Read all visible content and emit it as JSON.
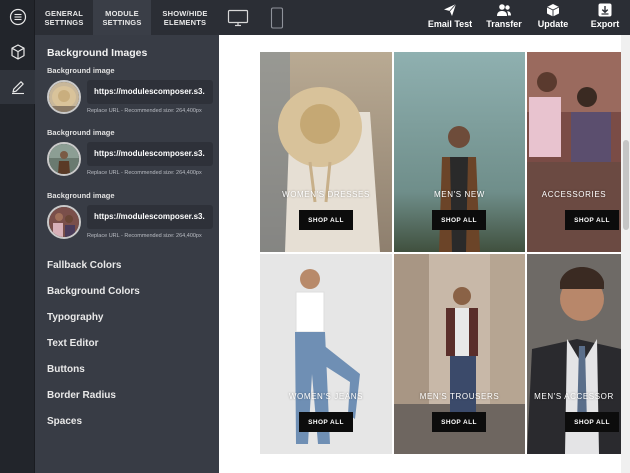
{
  "tabs": [
    {
      "label_1": "GENERAL",
      "label_2": "SETTINGS"
    },
    {
      "label_1": "MODULE",
      "label_2": "SETTINGS"
    },
    {
      "label_1": "SHOW/HIDE",
      "label_2": "ELEMENTS"
    }
  ],
  "actions": {
    "email_test": "Email Test",
    "transfer": "Transfer",
    "update": "Update",
    "export": "Export"
  },
  "panel": {
    "section_title": "Background Images",
    "images": [
      {
        "label": "Background image",
        "url": "https://modulescomposer.s3.",
        "hint": "Replace URL - Recommended size: 264,400px"
      },
      {
        "label": "Background image",
        "url": "https://modulescomposer.s3.",
        "hint": "Replace URL - Recommended size: 264,400px"
      },
      {
        "label": "Background image",
        "url": "https://modulescomposer.s3.",
        "hint": "Replace URL - Recommended size: 264,400px"
      }
    ],
    "menu": [
      "Fallback Colors",
      "Background Colors",
      "Typography",
      "Text Editor",
      "Buttons",
      "Border Radius",
      "Spaces"
    ]
  },
  "tiles": [
    {
      "caption": "WOMEN'S DRESSES",
      "button": "SHOP ALL"
    },
    {
      "caption": "MEN'S NEW",
      "button": "SHOP ALL"
    },
    {
      "caption": "ACCESSORIES",
      "button": "SHOP ALL"
    },
    {
      "caption": "WOMEN'S JEANS",
      "button": "SHOP ALL"
    },
    {
      "caption": "MEN'S TROUSERS",
      "button": "SHOP ALL"
    },
    {
      "caption": "MEN'S ACCESSOR",
      "button": "SHOP ALL"
    }
  ],
  "icons": {
    "rail": [
      "menu-icon",
      "cube-icon",
      "pencil-icon"
    ],
    "devices": [
      "desktop-icon",
      "mobile-icon"
    ],
    "actions": [
      "send-icon",
      "users-icon",
      "box-icon",
      "download-icon"
    ]
  }
}
